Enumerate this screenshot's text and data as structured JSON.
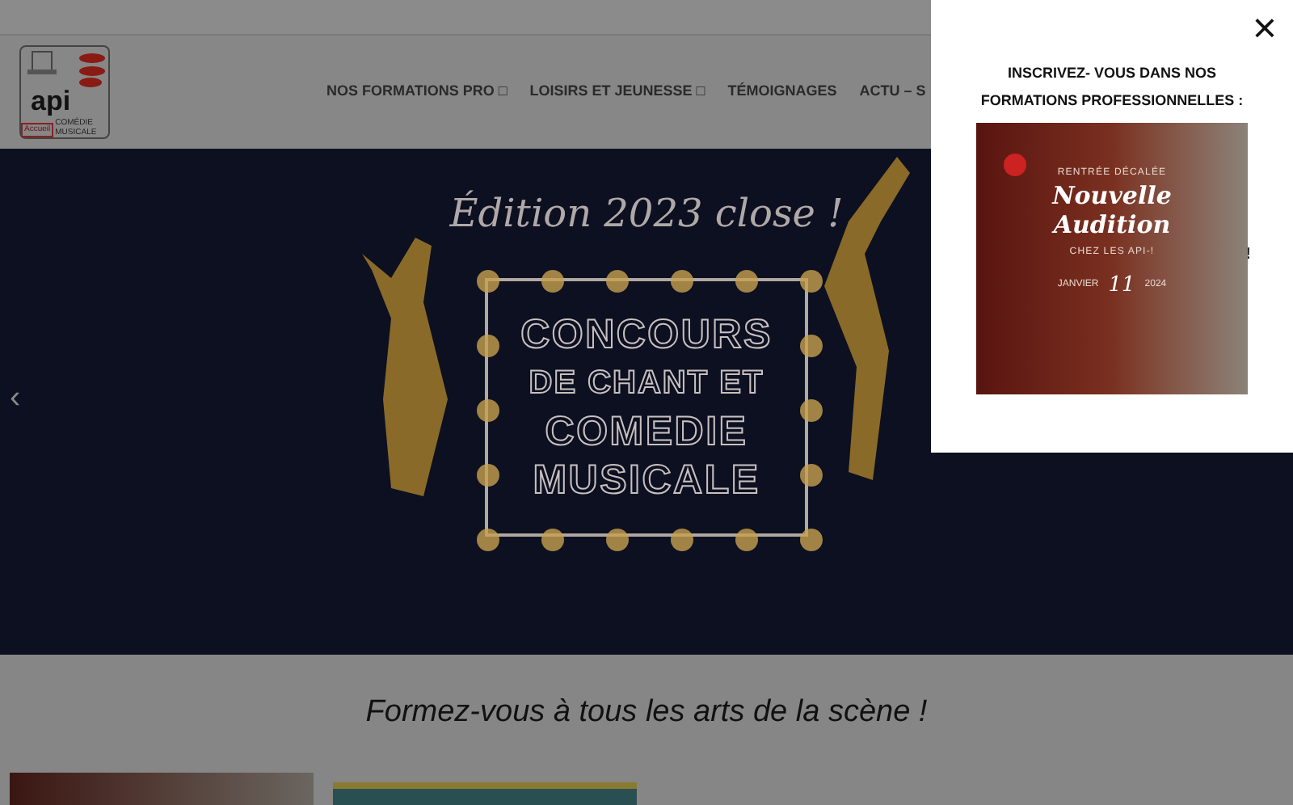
{
  "logo": {
    "text": "api",
    "subtitle": "COMÉDIE MUSICALE",
    "tag": "Accueil"
  },
  "nav": [
    {
      "label": "NOS FORMATIONS PRO □"
    },
    {
      "label": "LOISIRS ET JEUNESSE □"
    },
    {
      "label": "TÉMOIGNAGES"
    },
    {
      "label": "ACTU – S"
    }
  ],
  "banner": {
    "edition": "Édition 2023 close !",
    "lines": [
      "CONCOURS",
      "DE CHANT ET",
      "COMEDIE",
      "MUSICALE"
    ],
    "prev": "‹"
  },
  "section": {
    "heading": "Formez-vous à tous les arts de la scène !"
  },
  "popup": {
    "close": "×",
    "title": "INSCRIVEZ- VOUS DANS NOS FORMATIONS PROFESSIONNELLES :",
    "aside": "!",
    "poster": {
      "kicker": "RENTRÉE DÉCALÉE",
      "headline": [
        "Nouvelle",
        "Audition"
      ],
      "sub": "CHEZ LES API-!",
      "month": "JANVIER",
      "day": "11",
      "year": "2024"
    }
  }
}
